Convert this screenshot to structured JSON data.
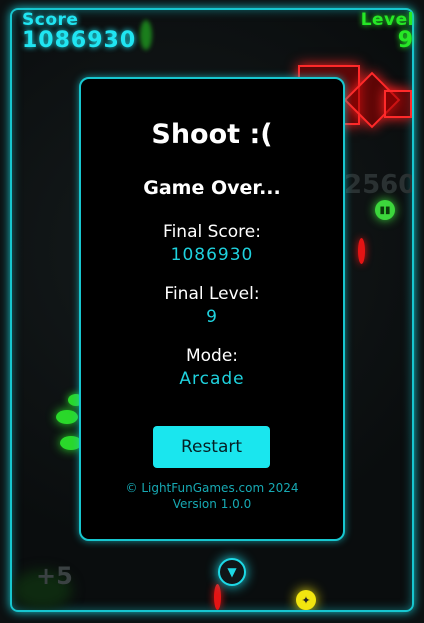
{
  "hud": {
    "score_label": "Score",
    "score_value": "1086930",
    "level_label": "Level",
    "level_value": "9"
  },
  "background": {
    "ghost_score": "2560",
    "bonus_popup": "+5"
  },
  "dialog": {
    "title": "Shoot :(",
    "subtitle": "Game Over...",
    "final_score_label": "Final Score:",
    "final_score_value": "1086930",
    "final_level_label": "Final Level:",
    "final_level_value": "9",
    "mode_label": "Mode:",
    "mode_value": "Arcade",
    "restart_label": "Restart",
    "copyright": "© LightFunGames.com 2024",
    "version": "Version 1.0.0"
  },
  "colors": {
    "accent_cyan": "#17c6cf",
    "level_green": "#26e826",
    "enemy_red": "#ff2a2a",
    "button_cyan": "#1ae6ee"
  },
  "icons": {
    "player": "player-ship-icon",
    "powerup": "star-powerup-icon",
    "enemy": "enemy-orb-icon"
  }
}
